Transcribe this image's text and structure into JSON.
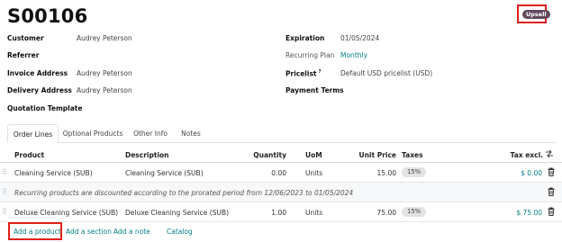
{
  "order": {
    "name": "S00106",
    "status_badge": "Upsell"
  },
  "fields_left": [
    {
      "label": "Customer",
      "value": "Audrey Peterson"
    },
    {
      "label": "Referrer",
      "value": ""
    },
    {
      "label": "Invoice Address",
      "value": "Audrey Peterson"
    },
    {
      "label": "Delivery Address",
      "value": "Audrey Peterson"
    },
    {
      "label": "Quotation Template",
      "value": ""
    }
  ],
  "fields_right": [
    {
      "label": "Expiration",
      "value": "01/05/2024"
    },
    {
      "label": "Recurring Plan",
      "value": "Monthly"
    },
    {
      "label": "Pricelist",
      "value": "Default USD pricelist (USD)"
    },
    {
      "label": "Payment Terms",
      "value": ""
    }
  ],
  "pricelist_help": "?",
  "tabs": [
    "Order Lines",
    "Optional Products",
    "Other Info",
    "Notes"
  ],
  "columns": {
    "product": "Product",
    "description": "Description",
    "quantity": "Quantity",
    "uom": "UoM",
    "unit_price": "Unit Price",
    "taxes": "Taxes",
    "tax_excl": "Tax excl."
  },
  "lines": [
    {
      "product": "Cleaning Service (SUB)",
      "description": "Cleaning Service (SUB)",
      "quantity": "0.00",
      "uom": "Units",
      "unit_price": "15.00",
      "tax": "15%",
      "subtotal": "$ 0.00"
    },
    {
      "note": "Recurring products are discounted according to the prorated period from 12/06/2023 to 01/05/2024"
    },
    {
      "product": "Deluxe Cleaning Service (SUB)",
      "description": "Deluxe Cleaning Service (SUB)",
      "quantity": "1.00",
      "uom": "Units",
      "unit_price": "75.00",
      "tax": "15%",
      "subtotal": "$ 75.00"
    }
  ],
  "actions": {
    "add_product": "Add a product",
    "add_section": "Add a section",
    "add_note": "Add a note",
    "catalog": "Catalog"
  },
  "colors": {
    "accent": "#017e84",
    "highlight": "#e0211b",
    "badge": "#614a5d"
  }
}
